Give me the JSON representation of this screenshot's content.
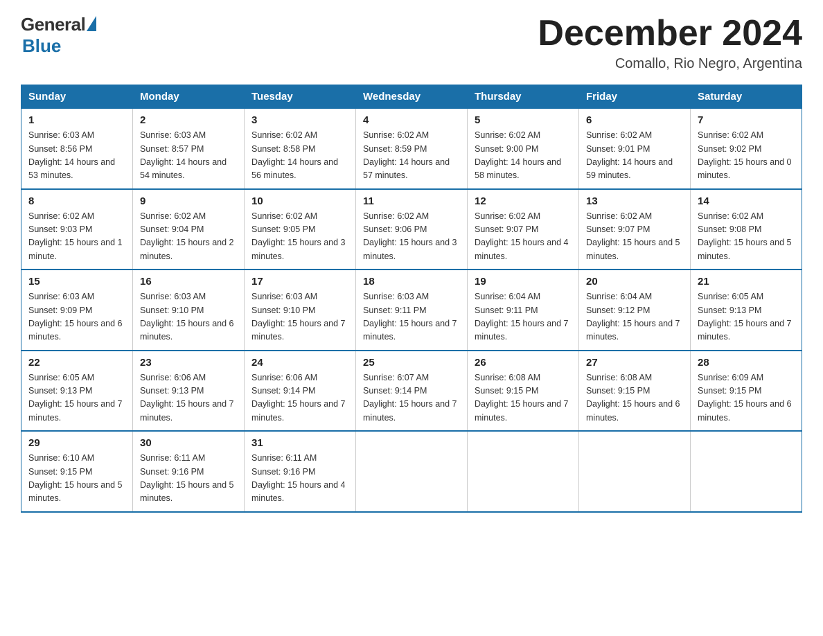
{
  "logo": {
    "general": "General",
    "blue": "Blue"
  },
  "title": "December 2024",
  "location": "Comallo, Rio Negro, Argentina",
  "headers": [
    "Sunday",
    "Monday",
    "Tuesday",
    "Wednesday",
    "Thursday",
    "Friday",
    "Saturday"
  ],
  "weeks": [
    [
      {
        "num": "1",
        "sunrise": "6:03 AM",
        "sunset": "8:56 PM",
        "daylight": "14 hours and 53 minutes."
      },
      {
        "num": "2",
        "sunrise": "6:03 AM",
        "sunset": "8:57 PM",
        "daylight": "14 hours and 54 minutes."
      },
      {
        "num": "3",
        "sunrise": "6:02 AM",
        "sunset": "8:58 PM",
        "daylight": "14 hours and 56 minutes."
      },
      {
        "num": "4",
        "sunrise": "6:02 AM",
        "sunset": "8:59 PM",
        "daylight": "14 hours and 57 minutes."
      },
      {
        "num": "5",
        "sunrise": "6:02 AM",
        "sunset": "9:00 PM",
        "daylight": "14 hours and 58 minutes."
      },
      {
        "num": "6",
        "sunrise": "6:02 AM",
        "sunset": "9:01 PM",
        "daylight": "14 hours and 59 minutes."
      },
      {
        "num": "7",
        "sunrise": "6:02 AM",
        "sunset": "9:02 PM",
        "daylight": "15 hours and 0 minutes."
      }
    ],
    [
      {
        "num": "8",
        "sunrise": "6:02 AM",
        "sunset": "9:03 PM",
        "daylight": "15 hours and 1 minute."
      },
      {
        "num": "9",
        "sunrise": "6:02 AM",
        "sunset": "9:04 PM",
        "daylight": "15 hours and 2 minutes."
      },
      {
        "num": "10",
        "sunrise": "6:02 AM",
        "sunset": "9:05 PM",
        "daylight": "15 hours and 3 minutes."
      },
      {
        "num": "11",
        "sunrise": "6:02 AM",
        "sunset": "9:06 PM",
        "daylight": "15 hours and 3 minutes."
      },
      {
        "num": "12",
        "sunrise": "6:02 AM",
        "sunset": "9:07 PM",
        "daylight": "15 hours and 4 minutes."
      },
      {
        "num": "13",
        "sunrise": "6:02 AM",
        "sunset": "9:07 PM",
        "daylight": "15 hours and 5 minutes."
      },
      {
        "num": "14",
        "sunrise": "6:02 AM",
        "sunset": "9:08 PM",
        "daylight": "15 hours and 5 minutes."
      }
    ],
    [
      {
        "num": "15",
        "sunrise": "6:03 AM",
        "sunset": "9:09 PM",
        "daylight": "15 hours and 6 minutes."
      },
      {
        "num": "16",
        "sunrise": "6:03 AM",
        "sunset": "9:10 PM",
        "daylight": "15 hours and 6 minutes."
      },
      {
        "num": "17",
        "sunrise": "6:03 AM",
        "sunset": "9:10 PM",
        "daylight": "15 hours and 7 minutes."
      },
      {
        "num": "18",
        "sunrise": "6:03 AM",
        "sunset": "9:11 PM",
        "daylight": "15 hours and 7 minutes."
      },
      {
        "num": "19",
        "sunrise": "6:04 AM",
        "sunset": "9:11 PM",
        "daylight": "15 hours and 7 minutes."
      },
      {
        "num": "20",
        "sunrise": "6:04 AM",
        "sunset": "9:12 PM",
        "daylight": "15 hours and 7 minutes."
      },
      {
        "num": "21",
        "sunrise": "6:05 AM",
        "sunset": "9:13 PM",
        "daylight": "15 hours and 7 minutes."
      }
    ],
    [
      {
        "num": "22",
        "sunrise": "6:05 AM",
        "sunset": "9:13 PM",
        "daylight": "15 hours and 7 minutes."
      },
      {
        "num": "23",
        "sunrise": "6:06 AM",
        "sunset": "9:13 PM",
        "daylight": "15 hours and 7 minutes."
      },
      {
        "num": "24",
        "sunrise": "6:06 AM",
        "sunset": "9:14 PM",
        "daylight": "15 hours and 7 minutes."
      },
      {
        "num": "25",
        "sunrise": "6:07 AM",
        "sunset": "9:14 PM",
        "daylight": "15 hours and 7 minutes."
      },
      {
        "num": "26",
        "sunrise": "6:08 AM",
        "sunset": "9:15 PM",
        "daylight": "15 hours and 7 minutes."
      },
      {
        "num": "27",
        "sunrise": "6:08 AM",
        "sunset": "9:15 PM",
        "daylight": "15 hours and 6 minutes."
      },
      {
        "num": "28",
        "sunrise": "6:09 AM",
        "sunset": "9:15 PM",
        "daylight": "15 hours and 6 minutes."
      }
    ],
    [
      {
        "num": "29",
        "sunrise": "6:10 AM",
        "sunset": "9:15 PM",
        "daylight": "15 hours and 5 minutes."
      },
      {
        "num": "30",
        "sunrise": "6:11 AM",
        "sunset": "9:16 PM",
        "daylight": "15 hours and 5 minutes."
      },
      {
        "num": "31",
        "sunrise": "6:11 AM",
        "sunset": "9:16 PM",
        "daylight": "15 hours and 4 minutes."
      },
      null,
      null,
      null,
      null
    ]
  ]
}
